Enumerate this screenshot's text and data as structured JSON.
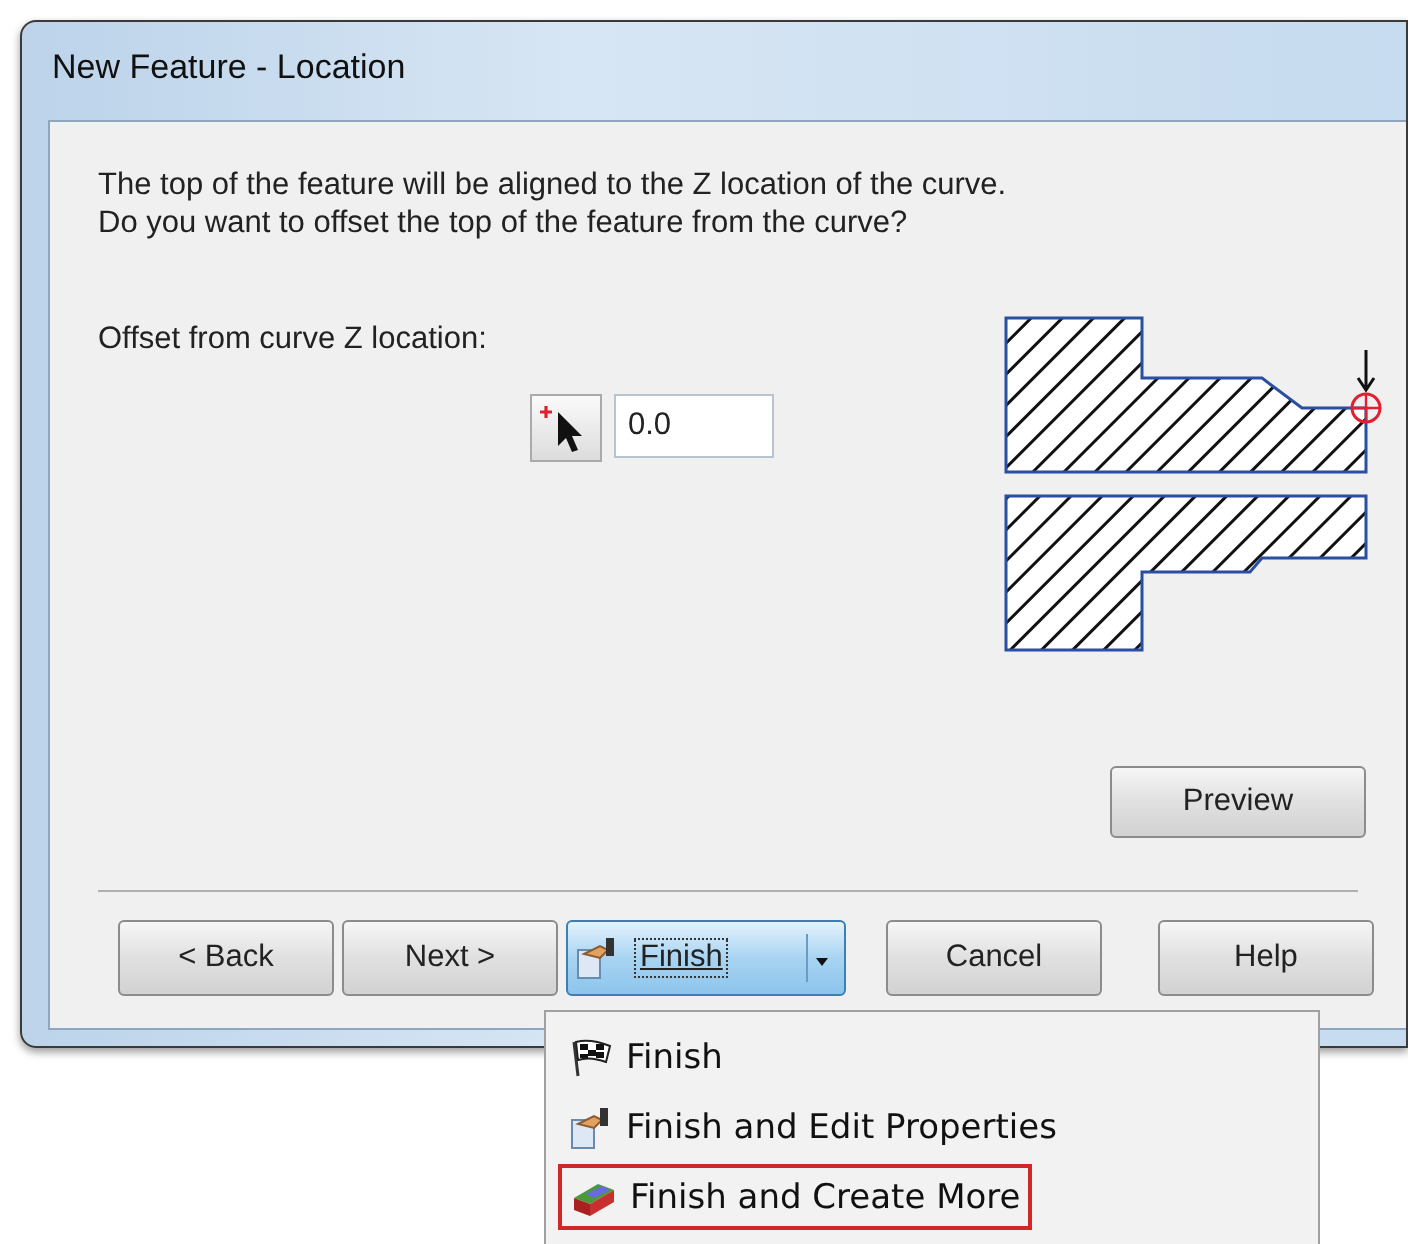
{
  "window": {
    "title": "New Feature - Location"
  },
  "message": "The top of the feature will be aligned to the Z location of the curve.\nDo you want to offset the top of the feature from the curve?",
  "offset": {
    "label": "Offset from curve Z location:",
    "value": "0.0"
  },
  "preview_button": "Preview",
  "buttons": [
    {
      "label": "< Back",
      "kind": "button",
      "pressed": false
    },
    {
      "label": "Next >",
      "kind": "button",
      "pressed": false
    },
    {
      "label": "Finish",
      "kind": "split",
      "pressed": true
    },
    {
      "label": "Cancel",
      "kind": "button",
      "pressed": false
    },
    {
      "label": "Help",
      "kind": "button",
      "pressed": false
    }
  ],
  "finish_menu": [
    {
      "label": "Finish",
      "kind": "flag",
      "selected": false
    },
    {
      "label": "Finish and Edit Properties",
      "kind": "edit",
      "selected": false
    },
    {
      "label": "Finish and Create More",
      "kind": "more",
      "selected": true
    }
  ]
}
